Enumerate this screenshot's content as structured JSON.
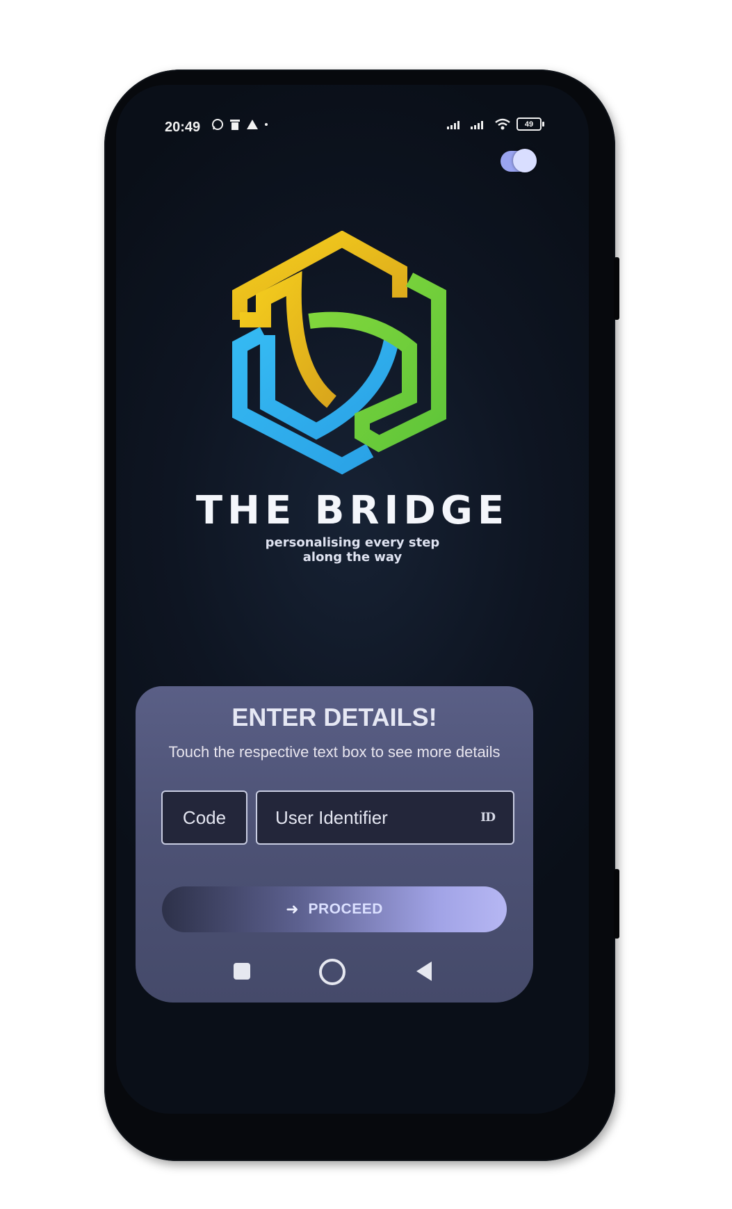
{
  "status_bar": {
    "time": "20:49",
    "left_icons": [
      "whatsapp-icon",
      "trash-icon",
      "alert-icon",
      "dot-icon"
    ],
    "right_icons": [
      "signal-icon",
      "signal-icon",
      "wifi-icon"
    ],
    "battery_level": "49"
  },
  "theme_toggle": {
    "state": "on"
  },
  "brand": {
    "title": "THE BRIDGE",
    "tagline_line1": "personalising every step",
    "tagline_line2": "along the way",
    "logo_colors": [
      "#f2c21b",
      "#2fb7f0",
      "#7ed63a"
    ]
  },
  "details": {
    "heading": "ENTER DETAILS!",
    "subtitle": "Touch the respective text box to see more details",
    "code_placeholder": "Code",
    "user_id_placeholder": "User Identifier",
    "user_id_icon": "ID",
    "proceed_label": "PROCEED",
    "proceed_icon": "arrow-right-icon"
  },
  "nav_bar": [
    "recents-icon",
    "home-icon",
    "back-icon"
  ]
}
